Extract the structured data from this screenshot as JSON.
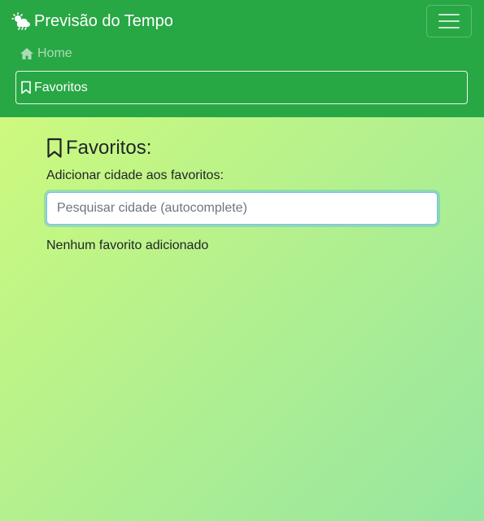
{
  "navbar": {
    "brand_title": "Previsão do Tempo",
    "brand_icon": "cloud-sun-rain-icon",
    "toggler_icon": "hamburger-menu-icon",
    "links": [
      {
        "label": "Home",
        "icon": "home-icon",
        "active": false
      },
      {
        "label": "Favoritos",
        "icon": "bookmark-icon",
        "active": true
      }
    ],
    "background_color": "#28a745"
  },
  "main": {
    "title": "Favoritos:",
    "title_icon": "bookmark-icon",
    "add_label": "Adicionar cidade aos favoritos:",
    "search": {
      "placeholder": "Pesquisar cidade (autocomplete)",
      "value": ""
    },
    "empty_message": "Nenhum favorito adicionado"
  },
  "colors": {
    "gradient_start": "#d4fc79",
    "gradient_end": "#96e6a1"
  }
}
